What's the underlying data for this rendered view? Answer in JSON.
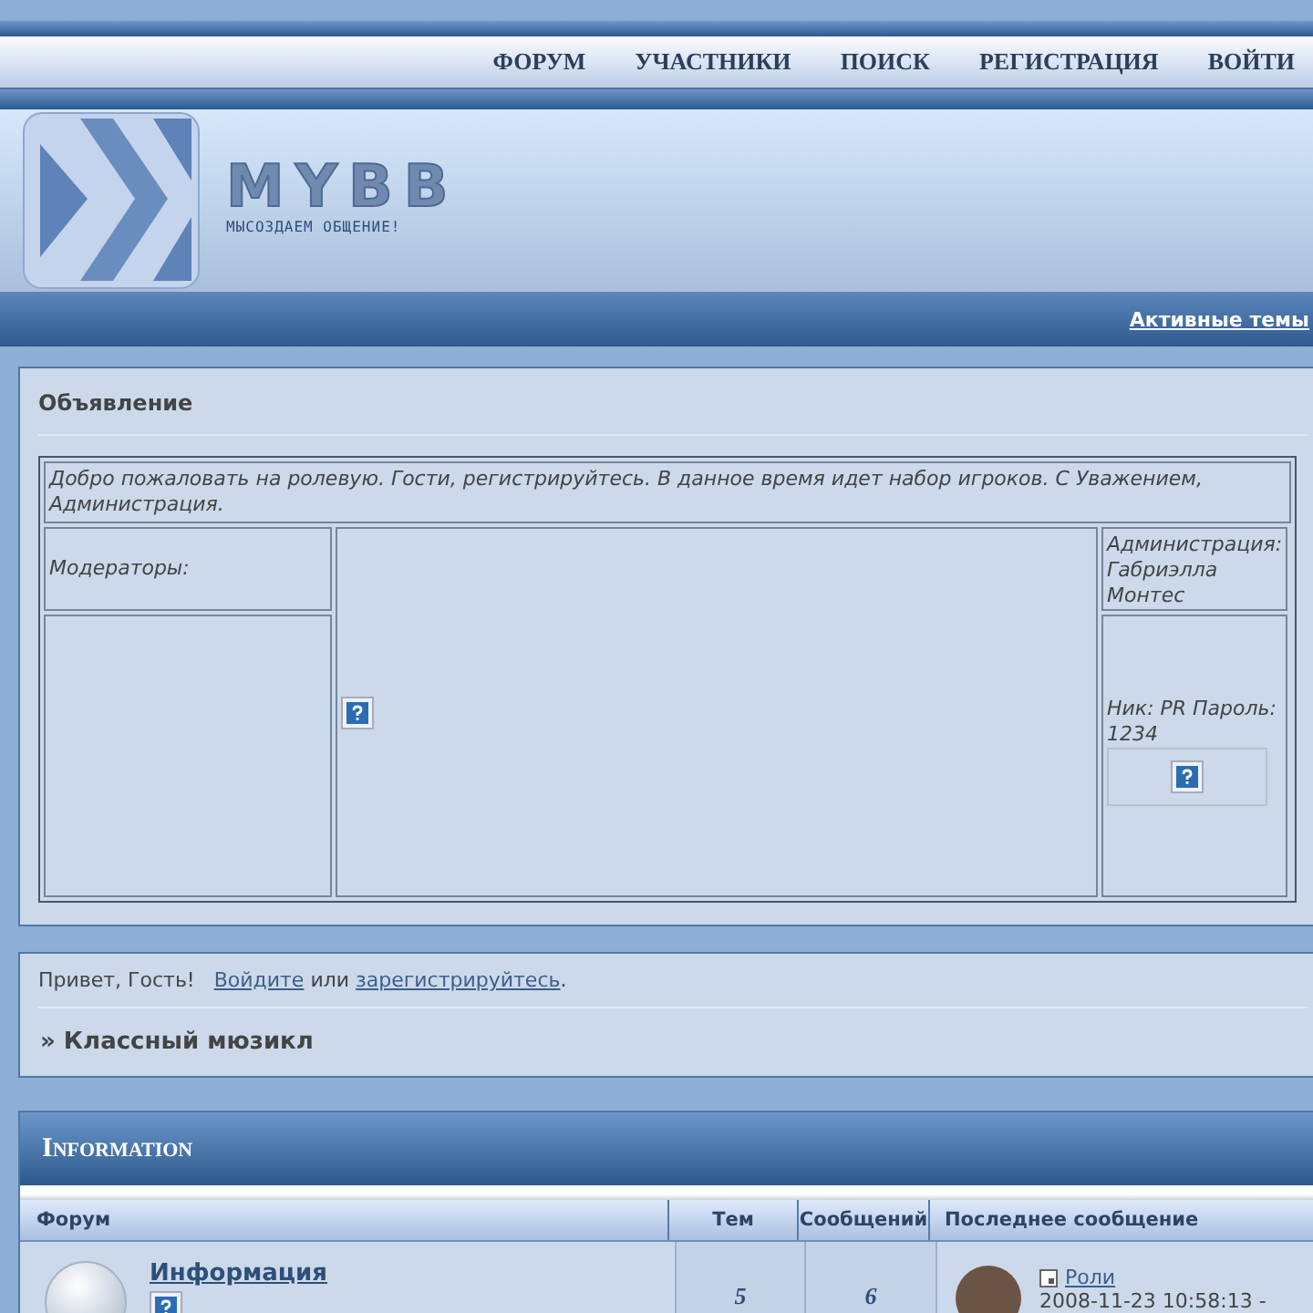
{
  "nav": {
    "items": [
      "ФОРУМ",
      "УЧАСТНИКИ",
      "ПОИСК",
      "РЕГИСТРАЦИЯ",
      "ВОЙТИ"
    ]
  },
  "logo": {
    "name": "MYBB",
    "tagline": "МЫСОЗДАЕМ ОБЩЕНИЕ!"
  },
  "subbar": {
    "link": "Активные темы"
  },
  "announcement": {
    "title": "Объявление",
    "message": "Добро пожаловать на ролевую. Гости, регистрируйтесь. В данное время идет набор игроков. С Уважением, Администрация.",
    "moderators_label": "Модераторы:",
    "admin_label": "Администрация: Габриэлла Монтес",
    "account_info": "Ник: PR Пароль: 1234"
  },
  "greeting": {
    "text": "Привет, Гость!",
    "login_link": "Войдите",
    "or": "или",
    "register_link": "зарегистрируйтесь",
    "end": ".",
    "breadcrumb": "» Классный мюзикл"
  },
  "category": {
    "title": "Information",
    "columns": [
      "Форум",
      "Тем",
      "Сообщений",
      "Последнее сообщение"
    ],
    "forums": [
      {
        "name": "Информация",
        "topics": "5",
        "posts": "6",
        "last_post": {
          "title": "Роли",
          "date": "2008-11-23 10:58:13 -"
        }
      }
    ]
  }
}
